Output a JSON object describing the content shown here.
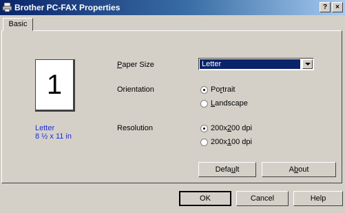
{
  "window": {
    "title": "Brother PC-FAX Properties",
    "help_button": "?",
    "close_button": "×"
  },
  "tabs": [
    {
      "label": "Basic"
    }
  ],
  "preview": {
    "page_number": "1",
    "paper_name": "Letter",
    "paper_dimensions": "8 ½ x 11 in"
  },
  "settings": {
    "paper_size": {
      "label_first": "P",
      "label_rest": "aper Size",
      "value": "Letter"
    },
    "orientation": {
      "label": "Orientation",
      "options": [
        {
          "pre": "Po",
          "key": "r",
          "post": "trait",
          "selected": true
        },
        {
          "pre": "",
          "key": "L",
          "post": "andscape",
          "selected": false
        }
      ]
    },
    "resolution": {
      "label": "Resolution",
      "options": [
        {
          "pre": "200x",
          "key": "2",
          "post": "00 dpi",
          "selected": true
        },
        {
          "pre": "200x",
          "key": "1",
          "post": "00 dpi",
          "selected": false
        }
      ]
    }
  },
  "panel_buttons": {
    "default": {
      "pre": "Defa",
      "key": "u",
      "post": "lt"
    },
    "about": {
      "pre": "A",
      "key": "b",
      "post": "out"
    }
  },
  "footer_buttons": {
    "ok": "OK",
    "cancel": "Cancel",
    "help": "Help"
  }
}
